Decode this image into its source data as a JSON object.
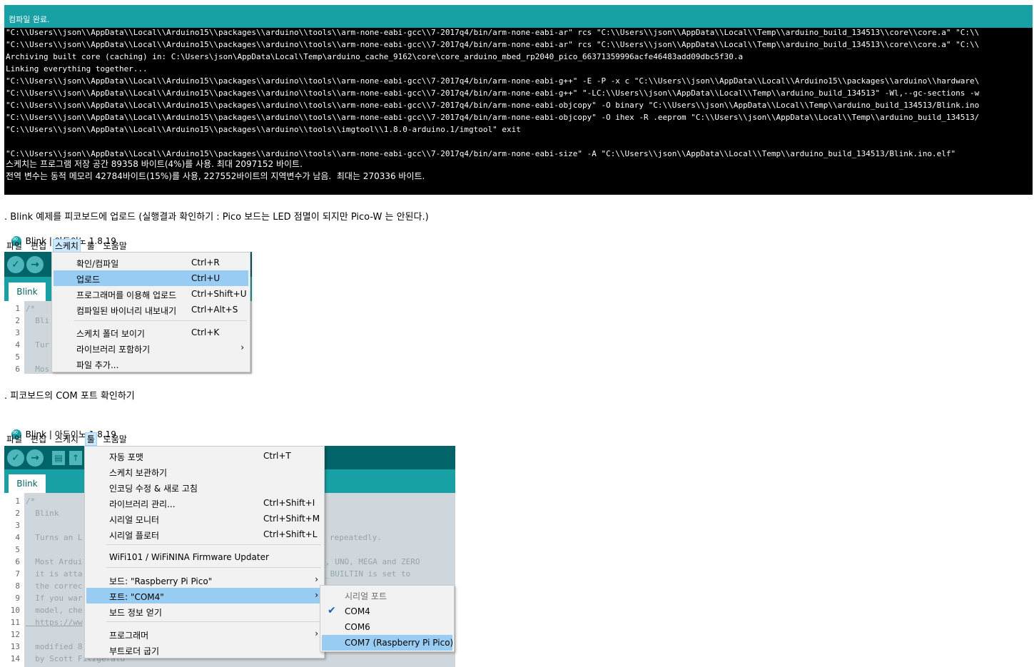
{
  "console": {
    "header": "컴파일 완료.",
    "lines": [
      "\"C:\\\\Users\\\\json\\\\AppData\\\\Local\\\\Arduino15\\\\packages\\\\arduino\\\\tools\\\\arm-none-eabi-gcc\\\\7-2017q4/bin/arm-none-eabi-ar\" rcs \"C:\\\\Users\\\\json\\\\AppData\\\\Local\\\\Temp\\\\arduino_build_134513\\\\core\\\\core.a\" \"C:\\\\",
      "\"C:\\\\Users\\\\json\\\\AppData\\\\Local\\\\Arduino15\\\\packages\\\\arduino\\\\tools\\\\arm-none-eabi-gcc\\\\7-2017q4/bin/arm-none-eabi-ar\" rcs \"C:\\\\Users\\\\json\\\\AppData\\\\Local\\\\Temp\\\\arduino_build_134513\\\\core\\\\core.a\" \"C:\\\\",
      "Archiving built core (caching) in: C:\\Users\\json\\AppData\\Local\\Temp\\arduino_cache_9162\\core\\core_arduino_mbed_rp2040_pico_66371359996acfe46483add09dbc5f30.a",
      "Linking everything together...",
      "\"C:\\\\Users\\\\json\\\\AppData\\\\Local\\\\Arduino15\\\\packages\\\\arduino\\\\tools\\\\arm-none-eabi-gcc\\\\7-2017q4/bin/arm-none-eabi-g++\" -E -P -x c \"C:\\\\Users\\\\json\\\\AppData\\\\Local\\\\Arduino15\\\\packages\\\\arduino\\\\hardware\\",
      "\"C:\\\\Users\\\\json\\\\AppData\\\\Local\\\\Arduino15\\\\packages\\\\arduino\\\\tools\\\\arm-none-eabi-gcc\\\\7-2017q4/bin/arm-none-eabi-g++\" \"-LC:\\\\Users\\\\json\\\\AppData\\\\Local\\\\Temp\\\\arduino_build_134513\" -Wl,--gc-sections -w",
      "\"C:\\\\Users\\\\json\\\\AppData\\\\Local\\\\Arduino15\\\\packages\\\\arduino\\\\tools\\\\arm-none-eabi-gcc\\\\7-2017q4/bin/arm-none-eabi-objcopy\" -O binary \"C:\\\\Users\\\\json\\\\AppData\\\\Local\\\\Temp\\\\arduino_build_134513/Blink.ino",
      "\"C:\\\\Users\\\\json\\\\AppData\\\\Local\\\\Arduino15\\\\packages\\\\arduino\\\\tools\\\\arm-none-eabi-gcc\\\\7-2017q4/bin/arm-none-eabi-objcopy\" -O ihex -R .eeprom \"C:\\\\Users\\\\json\\\\AppData\\\\Local\\\\Temp\\\\arduino_build_134513/",
      "\"C:\\\\Users\\\\json\\\\AppData\\\\Local\\\\Arduino15\\\\packages\\\\arduino\\\\tools\\\\imgtool\\\\1.8.0-arduino.1/imgtool\" exit",
      "",
      "\"C:\\\\Users\\\\json\\\\AppData\\\\Local\\\\Arduino15\\\\packages\\\\arduino\\\\tools\\\\arm-none-eabi-gcc\\\\7-2017q4/bin/arm-none-eabi-size\" -A \"C:\\\\Users\\\\json\\\\AppData\\\\Local\\\\Temp\\\\arduino_build_134513/Blink.ino.elf\"",
      "스케치는 프로그램 저장 공간 89358 바이트(4%)를 사용. 최대 2097152 바이트.",
      "전역 변수는 동적 메모리 42784바이트(15%)를 사용, 227552바이트의 지역변수가 남음.  최대는 270336 바이트."
    ]
  },
  "caption1": ". Blink 예제를 피코보드에 업로드 (실행결과 확인하기 : Pico 보드는 LED 점멸이 되지만 Pico-W 는 안된다.)",
  "caption2": ". 피코보드의 COM 포트 확인하기",
  "window1": {
    "title": "Blink | 아두이노 1.8.19",
    "menus": [
      "파일",
      "편집",
      "스케치",
      "툴",
      "도움말"
    ],
    "active_menu": "스케치",
    "tab": "Blink",
    "line_numbers": [
      "1",
      "2",
      "3",
      "4",
      "5",
      "6"
    ],
    "code": [
      "/*",
      "  Bli",
      "",
      "  Tur",
      "",
      "  Mos"
    ],
    "sketch_menu": [
      {
        "label": "확인/컴파일",
        "shortcut": "Ctrl+R"
      },
      {
        "label": "업로드",
        "shortcut": "Ctrl+U"
      },
      {
        "label": "프로그래머를 이용해 업로드",
        "shortcut": "Ctrl+Shift+U"
      },
      {
        "label": "컴파일된 바이너리 내보내기",
        "shortcut": "Ctrl+Alt+S"
      },
      {
        "label": "스케치 폴더 보이기",
        "shortcut": "Ctrl+K"
      },
      {
        "label": "라이브러리 포함하기",
        "shortcut": ""
      },
      {
        "label": "파일 추가...",
        "shortcut": ""
      }
    ],
    "highlighted_item": "업로드"
  },
  "window2": {
    "title": "Blink | 아두이노 1.8.19",
    "menus": [
      "파일",
      "편집",
      "스케치",
      "툴",
      "도움말"
    ],
    "active_menu": "툴",
    "tab": "Blink",
    "line_numbers": [
      "1",
      "2",
      "3",
      "4",
      "5",
      "6",
      "7",
      "8",
      "9",
      "10",
      "11",
      "12",
      "13",
      "14"
    ],
    "code": [
      "/*",
      "  Blink",
      "",
      "  Turns an L",
      "",
      "  Most Ardui",
      "  it is atta",
      "  the correc",
      "  If you war",
      "  model, che",
      "  https://ww",
      "",
      "  modified 8",
      "  by Scott Fitzgerald"
    ],
    "code_right": [
      {
        "line": 4,
        "text": "repeatedly."
      },
      {
        "line": 6,
        "text": ", UNO, MEGA and ZERO"
      },
      {
        "line": 7,
        "text": "_BUILTIN is set to"
      }
    ],
    "tools_menu": [
      {
        "label": "자동 포맷",
        "shortcut": "Ctrl+T"
      },
      {
        "label": "스케치 보관하기",
        "shortcut": ""
      },
      {
        "label": "인코딩 수정 & 새로 고침",
        "shortcut": ""
      },
      {
        "label": "라이브러리 관리...",
        "shortcut": "Ctrl+Shift+I"
      },
      {
        "label": "시리얼 모니터",
        "shortcut": "Ctrl+Shift+M"
      },
      {
        "label": "시리얼 플로터",
        "shortcut": "Ctrl+Shift+L"
      },
      {
        "label": "WiFi101 / WiFiNINA Firmware Updater",
        "shortcut": ""
      },
      {
        "label": "보드: \"Raspberry Pi Pico\"",
        "shortcut": ""
      },
      {
        "label": "포트: \"COM4\"",
        "shortcut": ""
      },
      {
        "label": "보드 정보 얻기",
        "shortcut": ""
      },
      {
        "label": "프로그래머",
        "shortcut": ""
      },
      {
        "label": "부트로더 굽기",
        "shortcut": ""
      }
    ],
    "highlighted_item": "포트: \"COM4\"",
    "port_submenu": {
      "header": "시리얼 포트",
      "items": [
        "COM4",
        "COM6",
        "COM7 (Raspberry Pi Pico)"
      ],
      "checked": "COM4",
      "highlighted": "COM7 (Raspberry Pi Pico)"
    }
  },
  "colors": {
    "teal_header": "#17a1a5",
    "toolbar": "#006468",
    "menu_highlight": "#99ccf3",
    "console_bg": "#000000"
  }
}
